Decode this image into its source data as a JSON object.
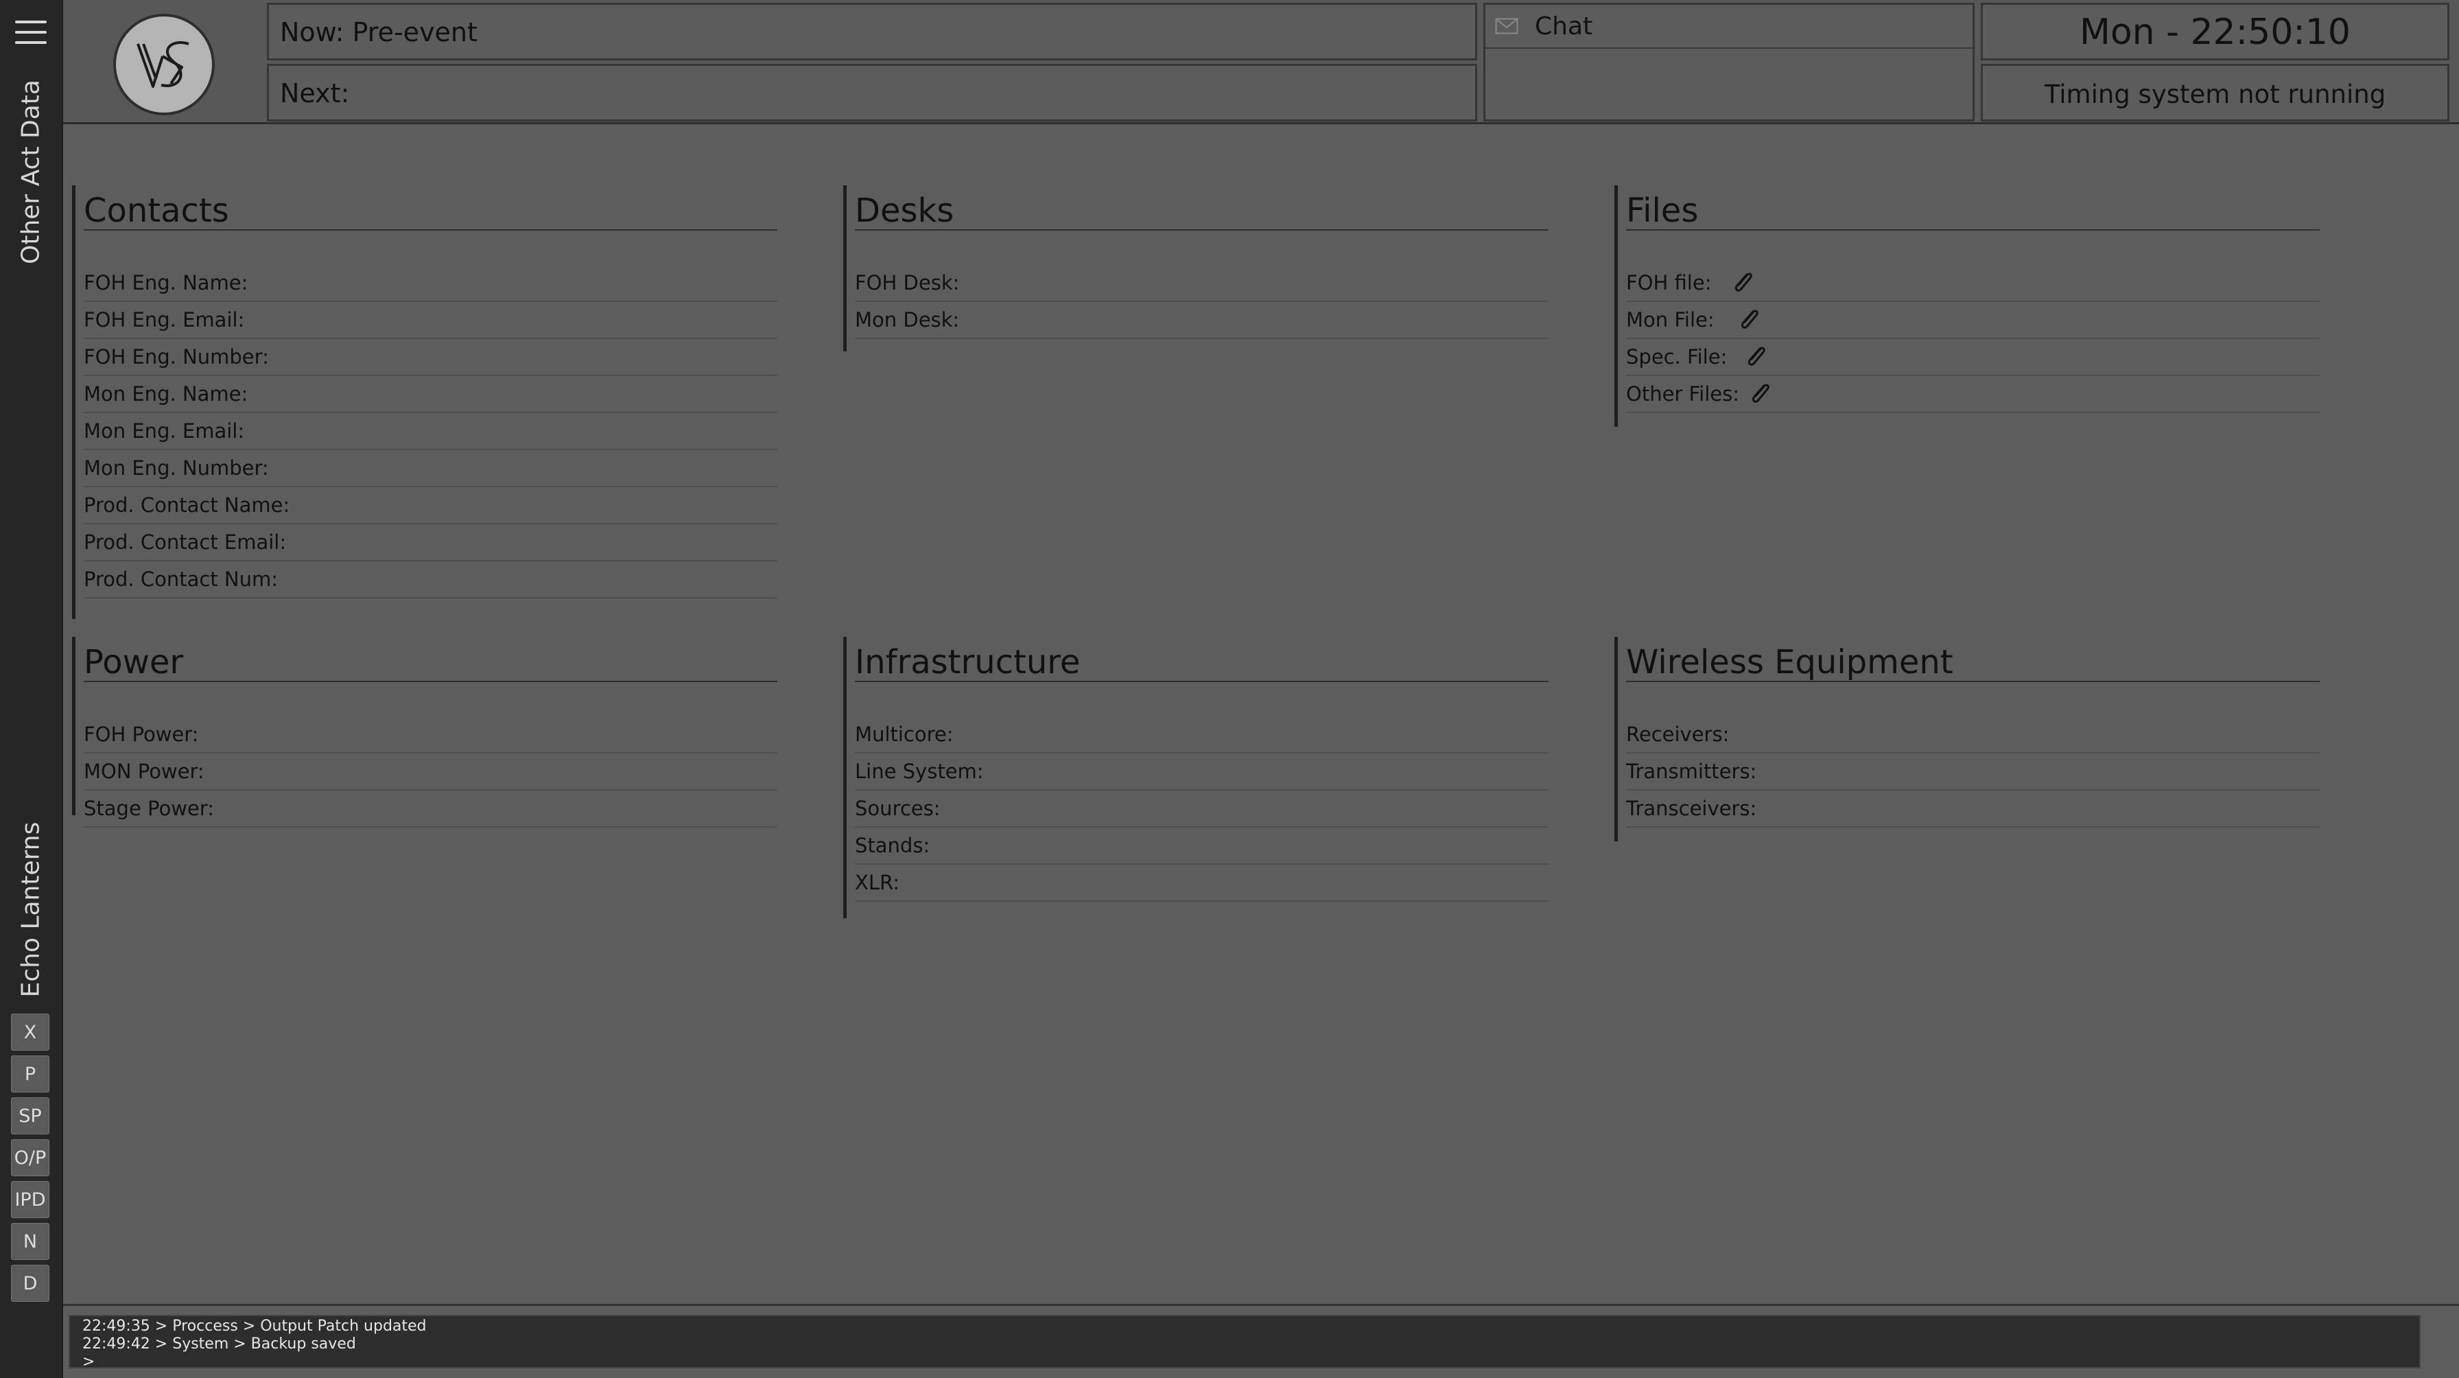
{
  "rail": {
    "top_label": "Other Act Data",
    "bottom_label": "Echo Lanterns",
    "buttons": [
      "X",
      "P",
      "SP",
      "O/P",
      "IPD",
      "N",
      "D"
    ]
  },
  "header": {
    "now": "Now: Pre-event",
    "next": "Next:",
    "chat": "Chat",
    "clock": "Mon - 22:50:10",
    "timing": "Timing system not running"
  },
  "sections": {
    "contacts": {
      "title": "Contacts",
      "rows": [
        "FOH Eng. Name:",
        "FOH Eng. Email:",
        "FOH Eng. Number:",
        "Mon Eng. Name:",
        "Mon Eng. Email:",
        "Mon Eng. Number:",
        "Prod. Contact Name:",
        "Prod. Contact Email:",
        "Prod. Contact Num:"
      ]
    },
    "desks": {
      "title": "Desks",
      "rows": [
        "FOH Desk:",
        "Mon Desk:"
      ]
    },
    "files": {
      "title": "Files",
      "rows": [
        "FOH file:",
        "Mon File:",
        "Spec. File:",
        "Other Files:"
      ]
    },
    "power": {
      "title": "Power",
      "rows": [
        "FOH Power:",
        "MON Power:",
        "Stage Power:"
      ]
    },
    "infrastructure": {
      "title": "Infrastructure",
      "rows": [
        "Multicore:",
        "Line System:",
        "Sources:",
        "Stands:",
        "XLR:"
      ]
    },
    "wireless": {
      "title": "Wireless Equipment",
      "rows": [
        "Receivers:",
        "Transmitters:",
        "Transceivers:"
      ]
    }
  },
  "console": {
    "lines": [
      "22:49:35 > Proccess > Output Patch updated",
      "22:49:42 > System > Backup saved",
      ">"
    ]
  }
}
